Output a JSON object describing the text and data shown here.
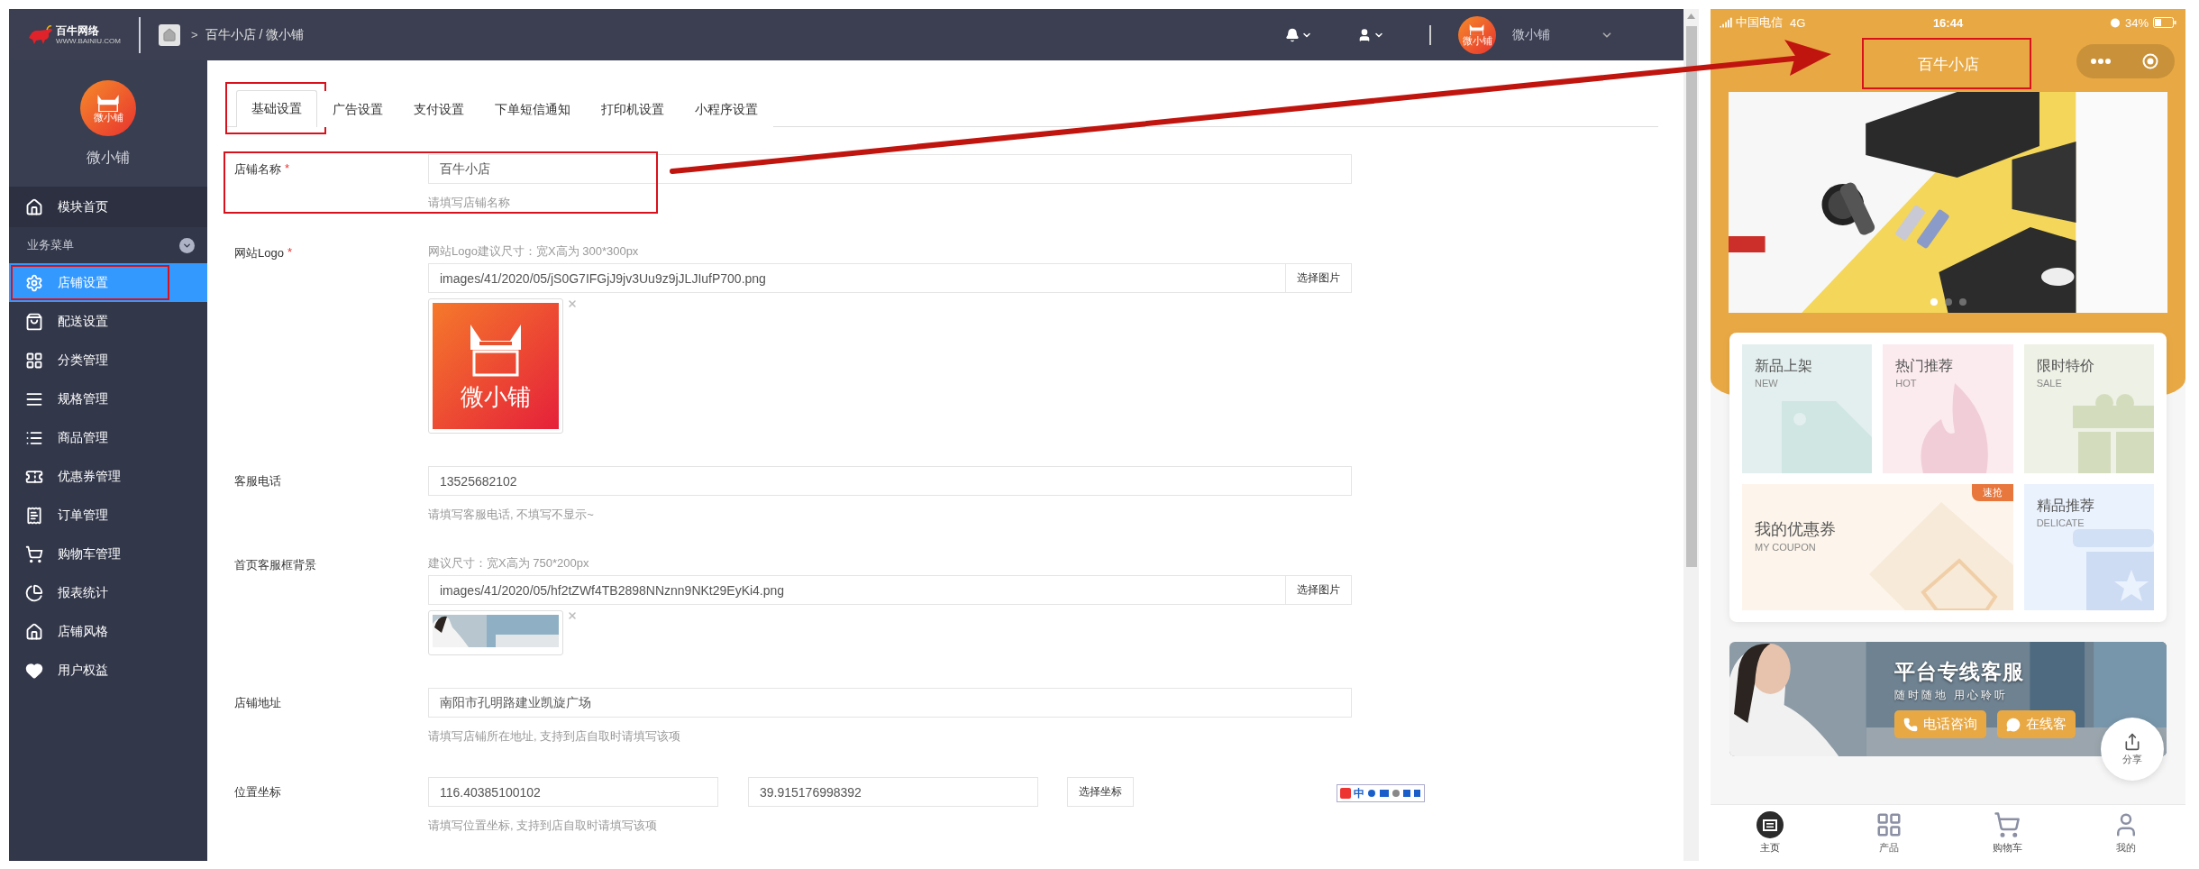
{
  "topbar": {
    "logo_text": "百牛网络",
    "logo_url": "WWW.BAINIU.COM",
    "breadcrumb_sep": ">",
    "breadcrumb": "百牛小店 / 微小铺",
    "avatar_text": "微小铺",
    "user_name": "微小铺"
  },
  "sidebar": {
    "avatar_text": "微小铺",
    "shop_name": "微小铺",
    "home": {
      "label": "模块首页"
    },
    "section": {
      "label": "业务菜单",
      "expanded": true
    },
    "items": [
      {
        "label": "店铺设置",
        "selected": true,
        "highlighted": true
      },
      {
        "label": "配送设置",
        "selected": false,
        "highlighted": false
      },
      {
        "label": "分类管理",
        "selected": false,
        "highlighted": false
      },
      {
        "label": "规格管理",
        "selected": false,
        "highlighted": false
      },
      {
        "label": "商品管理",
        "selected": false,
        "highlighted": false
      },
      {
        "label": "优惠券管理",
        "selected": false,
        "highlighted": false
      },
      {
        "label": "订单管理",
        "selected": false,
        "highlighted": false
      },
      {
        "label": "购物车管理",
        "selected": false,
        "highlighted": false
      },
      {
        "label": "报表统计",
        "selected": false,
        "highlighted": false
      },
      {
        "label": "店铺风格",
        "selected": false,
        "highlighted": false
      },
      {
        "label": "用户权益",
        "selected": false,
        "highlighted": false
      }
    ]
  },
  "tabs": [
    {
      "label": "基础设置",
      "selected": true,
      "highlighted": true
    },
    {
      "label": "广告设置",
      "selected": false,
      "highlighted": false
    },
    {
      "label": "支付设置",
      "selected": false,
      "highlighted": false
    },
    {
      "label": "下单短信通知",
      "selected": false,
      "highlighted": false
    },
    {
      "label": "打印机设置",
      "selected": false,
      "highlighted": false
    },
    {
      "label": "小程序设置",
      "selected": false,
      "highlighted": false
    }
  ],
  "form": [
    {
      "kind": "text",
      "label": "店铺名称",
      "required_mark": "*",
      "highlighted": true,
      "value": "百牛小店",
      "help": "请填写店铺名称"
    },
    {
      "label": "网站Logo",
      "required_mark": "*",
      "highlighted": false,
      "hint": "网站Logo建议尺寸：宽X高为 300*300px",
      "value": "images/41/2020/05/jS0G7IFGjJ9jv3Uu9z9jJLJIufP700.png",
      "button": "选择图片",
      "preview_text": "微小铺"
    },
    {
      "kind": "text",
      "label": "客服电话",
      "highlighted": false,
      "value": "13525682102",
      "help": "请填写客服电话, 不填写不显示~"
    },
    {
      "label": "首页客服框背景",
      "highlighted": false,
      "hint": "建议尺寸：宽X高为 750*200px",
      "value": "images/41/2020/05/hf2tZWf4TB2898NNznn9NKt29EyKi4.png",
      "button": "选择图片"
    },
    {
      "kind": "text",
      "label": "店铺地址",
      "highlighted": false,
      "value": "南阳市孔明路建业凯旋广场",
      "help": "请填写店铺所在地址, 支持到店自取时请填写该项"
    },
    {
      "kind": "coords",
      "label": "位置坐标",
      "highlighted": false,
      "values": [
        "116.40385100102",
        "39.915176998392"
      ],
      "button": "选择坐标",
      "help": "请填写位置坐标, 支持到店自取时请填写该项"
    }
  ],
  "ime_toolbar": {
    "label": "中"
  },
  "phone": {
    "status": {
      "carrier": "中国电信",
      "network": "4G",
      "time": "16:44",
      "battery": "34%"
    },
    "title": {
      "text": "百牛小店",
      "highlighted": true
    },
    "banner": {
      "dots": [
        {
          "selected": true
        },
        {
          "selected": false
        },
        {
          "selected": false
        }
      ]
    },
    "tiles": [
      {
        "title": "新品上架",
        "subtitle": "NEW",
        "color": "#e3efee",
        "wide": false
      },
      {
        "title": "热门推荐",
        "subtitle": "HOT",
        "color": "#fbeaee",
        "wide": false
      },
      {
        "title": "限时特价",
        "subtitle": "SALE",
        "color": "#eef1e5",
        "wide": false
      },
      {
        "title": "我的优惠券",
        "subtitle": "MY COUPON",
        "color": "#fdf5eb",
        "wide": true,
        "badge": "速抢"
      },
      {
        "title": "精品推荐",
        "subtitle": "DELICATE",
        "color": "#eaf2fd",
        "wide": false
      }
    ],
    "service": {
      "title": "平台专线客服",
      "subtitle": "随时随地  用心聆听",
      "buttons": [
        {
          "label": "电话咨询"
        },
        {
          "label": "在线客"
        }
      ]
    },
    "share": {
      "label": "分享"
    },
    "tabbar": [
      {
        "label": "主页",
        "selected": true
      },
      {
        "label": "产品",
        "selected": false
      },
      {
        "label": "购物车",
        "selected": false
      },
      {
        "label": "我的",
        "selected": false
      }
    ]
  }
}
